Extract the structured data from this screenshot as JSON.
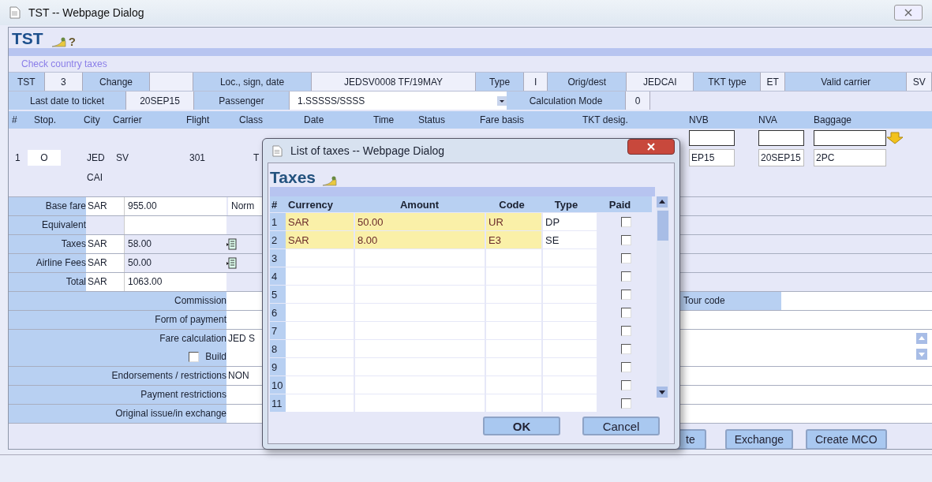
{
  "window": {
    "title": "TST -- Webpage Dialog"
  },
  "page": {
    "heading": "TST",
    "help": "?",
    "link": "Check country taxes"
  },
  "info_rows": [
    [
      {
        "kind": "text",
        "label": "TST",
        "value": "3"
      },
      {
        "kind": "text",
        "label": "Change"
      },
      {
        "kind": "text",
        "label": "Loc., sign, date",
        "value": "JEDSV0008 TF/19MAY"
      },
      {
        "kind": "text",
        "label": "Type",
        "value": "I"
      },
      {
        "kind": "text",
        "label": "Orig/dest",
        "value": "JEDCAI"
      },
      {
        "kind": "text",
        "label": "TKT type",
        "value": "ET"
      },
      {
        "kind": "text",
        "label": "Valid carrier",
        "value": "SV"
      }
    ],
    [
      {
        "kind": "text",
        "label": "Last date to ticket",
        "value": "20SEP15"
      },
      {
        "kind": "dropdown",
        "label": "Passenger",
        "value": "1.SSSSS/SSSS"
      },
      {
        "kind": "text",
        "label": "Calculation Mode",
        "value": "0"
      }
    ]
  ],
  "segment_columns": [
    "#",
    "Stop.",
    "City",
    "Carrier",
    "Flight",
    "Class",
    "Date",
    "Time",
    "Status",
    "Fare basis",
    "TKT desig.",
    "NVB",
    "NVA",
    "Baggage"
  ],
  "segment": {
    "number": "1",
    "stop": "O",
    "city_from": "JED",
    "city_to": "CAI",
    "carrier": "SV",
    "flight": "301",
    "class": "T",
    "nvb": "EP15",
    "nva": "20SEP15",
    "baggage": "2PC"
  },
  "fare_lines": [
    {
      "label": "Base fare",
      "currency": "SAR",
      "amount": "955.00",
      "extra": "Norm"
    },
    {
      "label": "Equivalent",
      "details_button": false
    },
    {
      "label": "Taxes",
      "currency": "SAR",
      "amount": "58.00",
      "details_button": true
    },
    {
      "label": "Airline Fees",
      "currency": "SAR",
      "amount": "50.00",
      "details_button": true
    },
    {
      "label": "Total",
      "currency": "SAR",
      "amount": "1063.00",
      "details_button": false
    }
  ],
  "ticket_fields": [
    {
      "kind": "with_tour_code",
      "label": "Commission",
      "tour_code": "Tour code"
    },
    {
      "kind": "plain",
      "label": "Form of payment"
    },
    {
      "kind": "calc",
      "label": "Fare calculation",
      "value": "JED S",
      "build": {
        "label": "Build",
        "checked": false
      }
    },
    {
      "kind": "plain",
      "label": "Endorsements / restrictions",
      "value": "NON"
    },
    {
      "kind": "plain",
      "label": "Payment restrictions"
    },
    {
      "kind": "plain",
      "label": "Original issue/in exchange"
    }
  ],
  "buttons": [
    "te",
    "Exchange",
    "Create MCO"
  ],
  "dialog": {
    "title": "List of taxes -- Webpage Dialog",
    "heading": "Taxes",
    "columns": [
      "#",
      "Currency",
      "Amount",
      "Code",
      "Type",
      "Paid"
    ],
    "rows": [
      {
        "number": "1",
        "currency": "SAR",
        "amount": "50.00",
        "code": "UR",
        "type": "DP",
        "paid": false
      },
      {
        "number": "2",
        "currency": "SAR",
        "amount": "8.00",
        "code": "E3",
        "type": "SE",
        "paid": false
      },
      {
        "number": "3",
        "paid": false
      },
      {
        "number": "4",
        "paid": false
      },
      {
        "number": "5",
        "paid": false
      },
      {
        "number": "6",
        "paid": false
      },
      {
        "number": "7",
        "paid": false
      },
      {
        "number": "8",
        "paid": false
      },
      {
        "number": "9",
        "paid": false
      },
      {
        "number": "10",
        "paid": false
      },
      {
        "number": "11",
        "paid": false
      }
    ],
    "buttons": [
      "OK",
      "Cancel"
    ]
  }
}
